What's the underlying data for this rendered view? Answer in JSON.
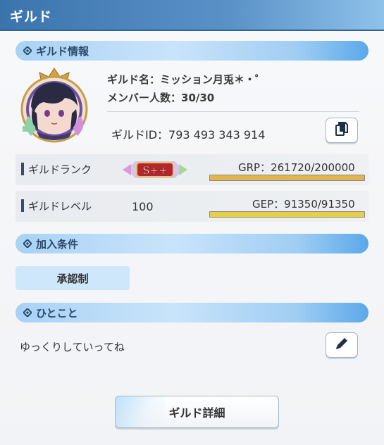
{
  "window": {
    "title": "ギルド"
  },
  "guild_info": {
    "section_title": "ギルド情報",
    "name_line": "ギルド名：ミッション月兎＊・゜",
    "members_line": "メンバー人数：30/30",
    "id_line": "ギルドID：793 493 343 914"
  },
  "rank": {
    "label": "ギルドランク",
    "badge": "S++",
    "points_text": "GRP：261720/200000",
    "progress": 1.0,
    "bar_color": "#e3b44e"
  },
  "level": {
    "label": "ギルドレベル",
    "value": "100",
    "points_text": "GEP：91350/91350",
    "progress": 1.0,
    "bar_color": "#e6cf45"
  },
  "join": {
    "section_title": "加入条件",
    "condition": "承認制"
  },
  "comment": {
    "section_title": "ひとこと",
    "text": "ゆっくりしていってね"
  },
  "footer": {
    "detail_button": "ギルド詳細"
  },
  "colors": {
    "header_blue": "#3b74ac",
    "section_blue": "#a9d2f5",
    "accent_navy": "#2a4a6b"
  },
  "icons": {
    "copy": "copy-icon",
    "edit": "pencil-icon",
    "section": "diamond-icon"
  }
}
